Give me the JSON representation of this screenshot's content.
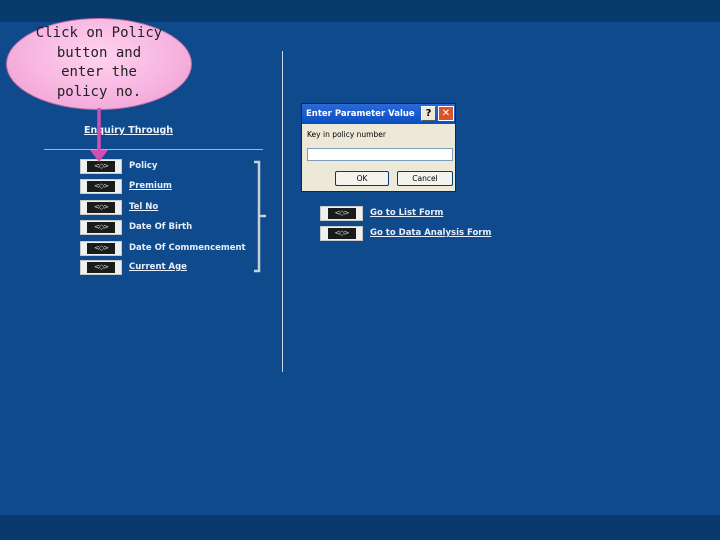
{
  "callout": {
    "text": "Click on Policy button and enter the policy no."
  },
  "left_panel": {
    "heading": "Enquiry Through",
    "items": [
      {
        "label": "Policy",
        "icon": "form-button-icon"
      },
      {
        "label": "Premium",
        "icon": "form-button-icon"
      },
      {
        "label": "Tel No",
        "icon": "form-button-icon"
      },
      {
        "label": "Date Of Birth",
        "icon": "form-button-icon"
      },
      {
        "label": "Date Of Commencement",
        "icon": "form-button-icon"
      },
      {
        "label": "Current Age",
        "icon": "form-button-icon"
      }
    ]
  },
  "right_panel": {
    "items": [
      {
        "label": "Go to List Form",
        "icon": "form-button-icon"
      },
      {
        "label": "Go to Data Analysis Form",
        "icon": "form-button-icon"
      }
    ]
  },
  "dialog": {
    "title": "Enter Parameter Value",
    "help_label": "?",
    "close_label": "✕",
    "prompt": "Key in policy number",
    "input_value": "",
    "ok_label": "OK",
    "cancel_label": "Cancel"
  },
  "colors": {
    "background": "#0e4a8c",
    "band": "#093a6e",
    "callout_fill": "#f6b2df",
    "pointer": "#d04fb0",
    "dialog_title": "#0a4fc0"
  }
}
